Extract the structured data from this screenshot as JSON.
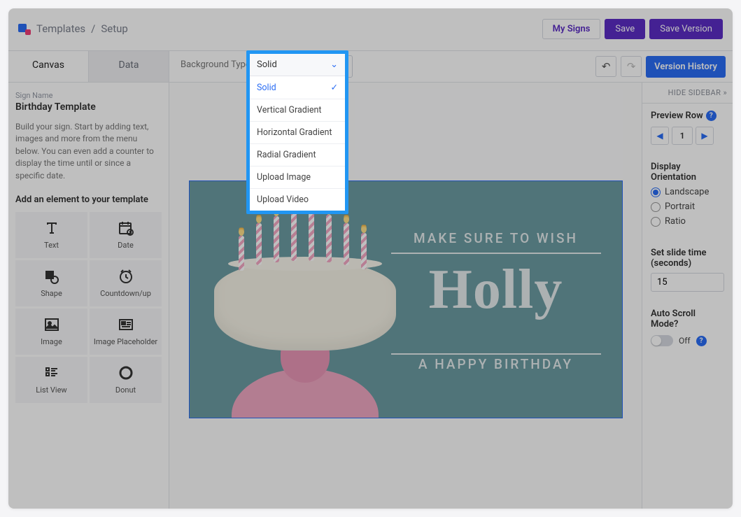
{
  "breadcrumb": {
    "root": "Templates",
    "sep": "/",
    "current": "Setup"
  },
  "header_actions": {
    "my_signs": "My Signs",
    "save": "Save",
    "save_version": "Save Version"
  },
  "tabs": {
    "canvas": "Canvas",
    "data": "Data"
  },
  "bg": {
    "label": "Background Type",
    "selected": "Solid",
    "options": [
      "Solid",
      "Vertical Gradient",
      "Horizontal Gradient",
      "Radial Gradient",
      "Upload Image",
      "Upload Video"
    ]
  },
  "toolbar": {
    "version_history": "Version History"
  },
  "left": {
    "sign_name_label": "Sign Name",
    "sign_name": "Birthday Template",
    "help": "Build your sign. Start by adding text, images and more from the menu below. You can even add a counter to display the time until or since a specific date.",
    "add_heading": "Add an element to your template",
    "elements": {
      "text": "Text",
      "date": "Date",
      "shape": "Shape",
      "countdown": "Countdown/up",
      "image": "Image",
      "placeholder": "Image Placeholder",
      "listview": "List View",
      "donut": "Donut"
    }
  },
  "canvas_text": {
    "top": "MAKE SURE TO WISH",
    "name": "Holly",
    "bottom": "A HAPPY BIRTHDAY"
  },
  "right": {
    "hide": "HIDE SIDEBAR",
    "preview_row": "Preview Row",
    "page": "1",
    "display_orientation": "Display Orientation",
    "landscape": "Landscape",
    "portrait": "Portrait",
    "ratio": "Ratio",
    "slide_label1": "Set slide time",
    "slide_label2": "(seconds)",
    "slide_value": "15",
    "auto_label": "Auto Scroll Mode?",
    "auto_state": "Off"
  }
}
